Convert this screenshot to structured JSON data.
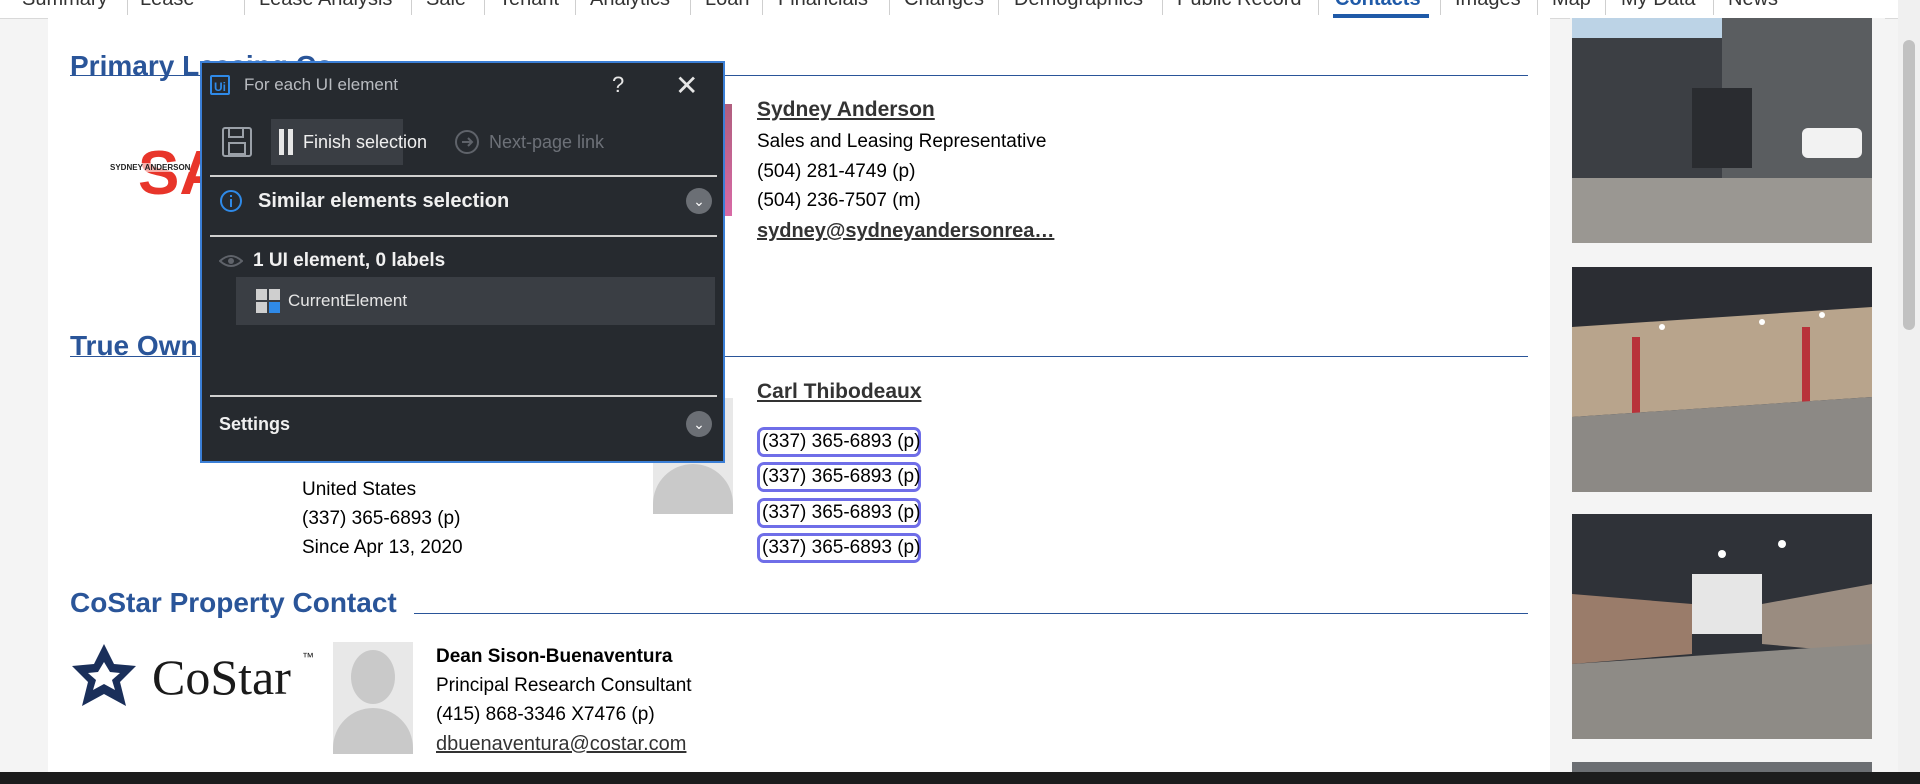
{
  "tabs": [
    {
      "label": "Summary"
    },
    {
      "label": "Lease"
    },
    {
      "label": "Lease Analysis"
    },
    {
      "label": "Sale"
    },
    {
      "label": "Tenant"
    },
    {
      "label": "Analytics"
    },
    {
      "label": "Loan"
    },
    {
      "label": "Financials"
    },
    {
      "label": "Changes"
    },
    {
      "label": "Demographics"
    },
    {
      "label": "Public Record"
    },
    {
      "label": "Contacts",
      "active": true
    },
    {
      "label": "Images"
    },
    {
      "label": "Map"
    },
    {
      "label": "My Data"
    },
    {
      "label": "News"
    }
  ],
  "sections": {
    "primary_leasing": {
      "title": "Primary Leasing Co"
    },
    "true_owner": {
      "title": "True Own"
    },
    "costar_contact": {
      "title": "CoStar Property Contact"
    }
  },
  "primary_contact": {
    "logo_text": "SYDNEY ANDERSON",
    "name": "Sydney Anderson",
    "role": "Sales and Leasing Representative",
    "phone_p": "(504) 281-4749 (p)",
    "phone_m": "(504) 236-7507 (m)",
    "email": "sydney@sydneyandersonrea…"
  },
  "owner": {
    "country": "United States",
    "phone": "(337) 365-6893 (p)",
    "since": "Since Apr 13, 2020",
    "contact_name": "Carl Thibodeaux",
    "highlighted_phones": [
      "(337) 365-6893 (p)",
      "(337) 365-6893 (p)",
      "(337) 365-6893 (p)",
      "(337) 365-6893 (p)"
    ]
  },
  "costar": {
    "logo_text": "CoStar",
    "logo_tm": "™",
    "name": "Dean Sison-Buenaventura",
    "role": "Principal Research Consultant",
    "phone": "(415) 868-3346 X7476 (p)",
    "email": "dbuenaventura@costar.com"
  },
  "dialog": {
    "logo": "Ui",
    "title": "For each UI element",
    "help": "?",
    "close": "✕",
    "finish_label": "Finish selection",
    "next_page_label": "Next-page link",
    "similar_label": "Similar elements selection",
    "count_label": "1 UI element, 0 labels",
    "element_label": "CurrentElement",
    "settings_label": "Settings",
    "chevron": "⌄"
  },
  "colors": {
    "accent": "#2a5599",
    "dialog_bg": "#262a2f",
    "dialog_border": "#3b7fd6",
    "selection_outline": "#6f6ee8"
  }
}
